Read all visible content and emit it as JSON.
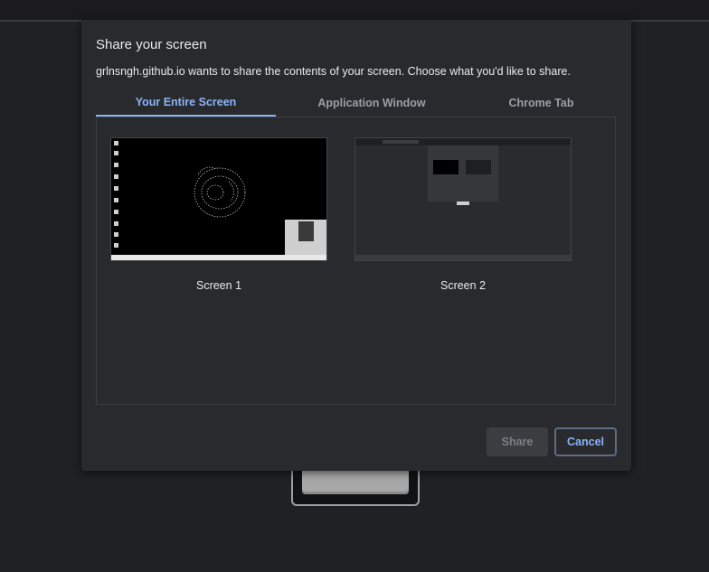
{
  "dialog": {
    "title": "Share your screen",
    "subtitle": "grlnsngh.github.io wants to share the contents of your screen. Choose what you'd like to share.",
    "tabs": [
      {
        "label": "Your Entire Screen",
        "active": true
      },
      {
        "label": "Application Window",
        "active": false
      },
      {
        "label": "Chrome Tab",
        "active": false
      }
    ],
    "sources": [
      {
        "label": "Screen 1"
      },
      {
        "label": "Screen 2"
      }
    ],
    "buttons": {
      "share_label": "Share",
      "cancel_label": "Cancel"
    }
  },
  "colors": {
    "accent": "#8ab4f8",
    "dialog_bg": "#292a2d",
    "page_bg": "#202124"
  }
}
